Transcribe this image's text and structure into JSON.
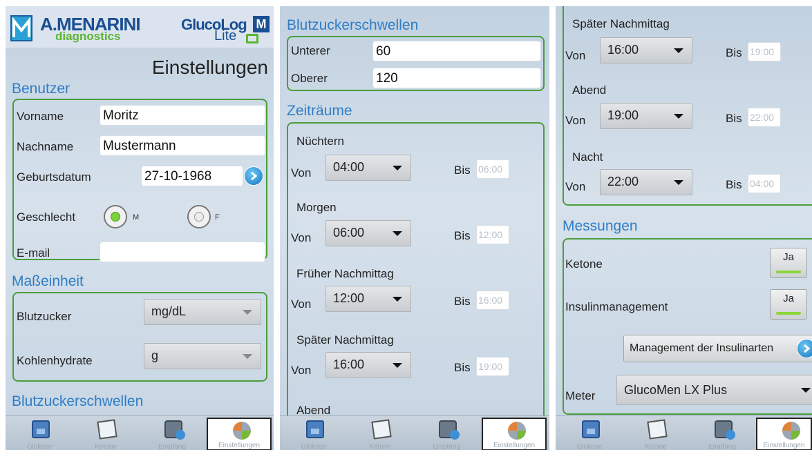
{
  "brand": {
    "company": "A.MENARINI",
    "division": "diagnostics",
    "app_name": "GlucoLog",
    "app_badge": "M",
    "edition": "Lite"
  },
  "screen1": {
    "title": "Einstellungen",
    "benutzer_header": "Benutzer",
    "vorname_label": "Vorname",
    "vorname_value": "Moritz",
    "nachname_label": "Nachname",
    "nachname_value": "Mustermann",
    "geburtsdatum_label": "Geburtsdatum",
    "geburtsdatum_value": "27-10-1968",
    "geschlecht_label": "Geschlecht",
    "gender_m": "M",
    "gender_f": "F",
    "email_label": "E-mail",
    "email_value": "",
    "masseinheit_header": "Maßeinheit",
    "blutzucker_label": "Blutzucker",
    "blutzucker_value": "mg/dL",
    "kohlenhydrate_label": "Kohlenhydrate",
    "kohlenhydrate_value": "g",
    "schwellen_header": "Blutzuckerschwellen"
  },
  "screen2": {
    "schwellen_header": "Blutzuckerschwellen",
    "unterer_label": "Unterer",
    "unterer_value": "60",
    "oberer_label": "Oberer",
    "oberer_value": "120",
    "zeitraeume_header": "Zeiträume",
    "periods": [
      {
        "name": "Nüchtern",
        "von_label": "Von",
        "von": "04:00",
        "bis_label": "Bis",
        "bis": "06:00"
      },
      {
        "name": "Morgen",
        "von_label": "Von",
        "von": "06:00",
        "bis_label": "Bis",
        "bis": "12:00"
      },
      {
        "name": "Früher Nachmittag",
        "von_label": "Von",
        "von": "12:00",
        "bis_label": "Bis",
        "bis": "16:00"
      },
      {
        "name": "Später Nachmittag",
        "von_label": "Von",
        "von": "16:00",
        "bis_label": "Bis",
        "bis": "19:00"
      },
      {
        "name": "Abend"
      }
    ]
  },
  "screen3": {
    "periods": [
      {
        "name": "Später Nachmittag",
        "von_label": "Von",
        "von": "16:00",
        "bis_label": "Bis",
        "bis": "19:00"
      },
      {
        "name": "Abend",
        "von_label": "Von",
        "von": "19:00",
        "bis_label": "Bis",
        "bis": "22:00"
      },
      {
        "name": "Nacht",
        "von_label": "Von",
        "von": "22:00",
        "bis_label": "Bis",
        "bis": "04:00"
      }
    ],
    "messungen_header": "Messungen",
    "ketone_label": "Ketone",
    "ketone_value": "Ja",
    "insulin_label": "Insulinmanagement",
    "insulin_value": "Ja",
    "insulinarten_button": "Management der Insulinarten",
    "meter_label": "Meter",
    "meter_value": "GlucoMen LX Plus"
  },
  "tabs": [
    {
      "label": "Glukose",
      "icon": "calendar-icon"
    },
    {
      "label": "Ketone",
      "icon": "ketone-strip-icon"
    },
    {
      "label": "Empfang",
      "icon": "meter-receive-icon"
    },
    {
      "label": "Einstellungen",
      "icon": "settings-gears-icon"
    }
  ],
  "colors": {
    "section_header": "#2f7dc6",
    "panel_border": "#4a9d3d",
    "brand_blue": "#1a4f94",
    "brand_green": "#5bb431",
    "toggle_on": "#8bd63a"
  }
}
